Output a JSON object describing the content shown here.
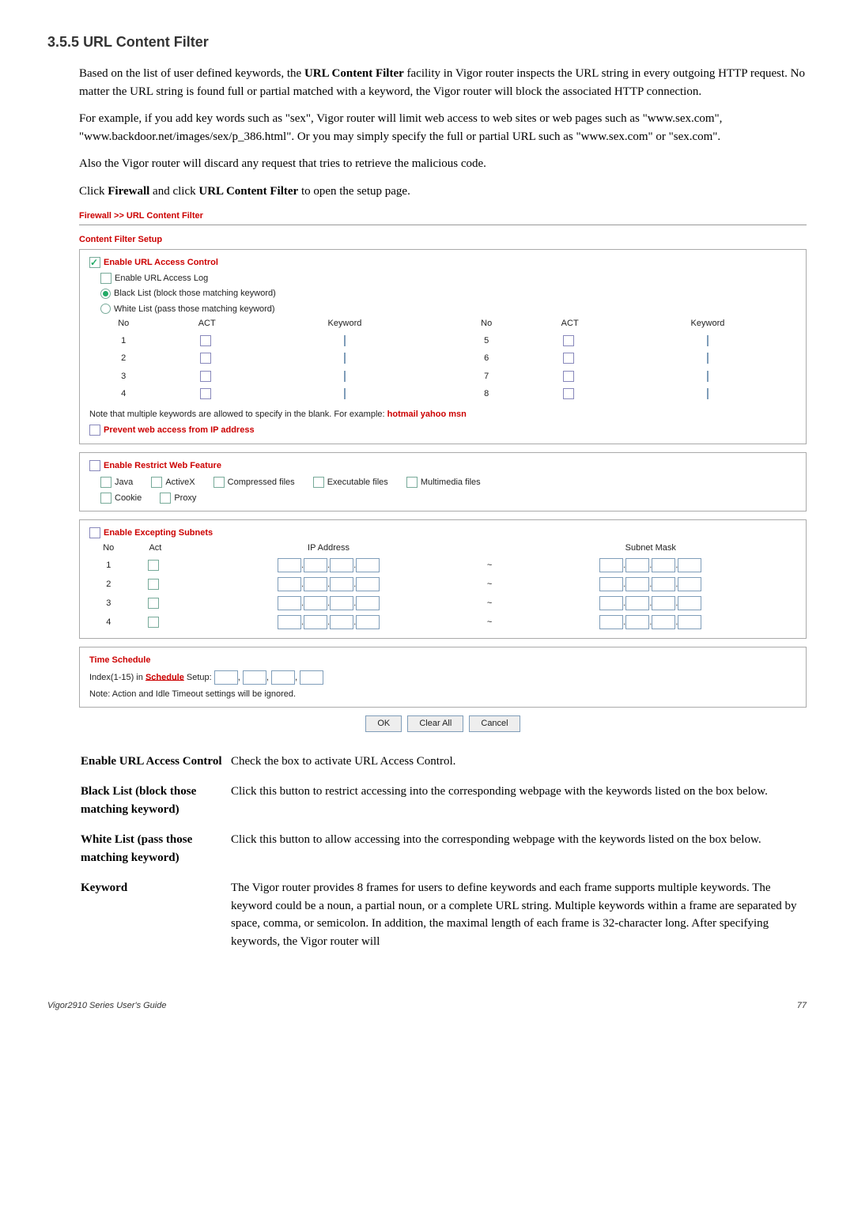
{
  "section": {
    "number": "3.5.5",
    "title": "URL Content Filter"
  },
  "para1_a": "Based on the list of user defined keywords, the ",
  "para1_b": "URL Content Filter",
  "para1_c": " facility in Vigor router inspects the URL string in every outgoing HTTP request. No matter the URL string is found full or partial matched with a keyword, the Vigor router will block the associated HTTP connection.",
  "para2": "For example, if you add key words such as \"sex\", Vigor router will limit web access to web sites or web pages such as \"www.sex.com\", \"www.backdoor.net/images/sex/p_386.html\". Or you may simply specify the full or partial URL such as \"www.sex.com\" or \"sex.com\".",
  "para3": "Also the Vigor router will discard any request that tries to retrieve the malicious code.",
  "para4_a": "Click ",
  "para4_b": "Firewall",
  "para4_c": " and click ",
  "para4_d": "URL Content Filter",
  "para4_e": " to open the setup page.",
  "shot": {
    "breadcrumb": "Firewall >> URL Content Filter",
    "cfs_title": "Content Filter Setup",
    "enable_uac": "Enable URL Access Control",
    "enable_log": "Enable URL Access Log",
    "black_list": "Black List (block those matching keyword)",
    "white_list": "White List (pass those matching keyword)",
    "hdr_no": "No",
    "hdr_act": "ACT",
    "hdr_kw": "Keyword",
    "rows_left": [
      "1",
      "2",
      "3",
      "4"
    ],
    "rows_right": [
      "5",
      "6",
      "7",
      "8"
    ],
    "note_a": "Note that multiple keywords are allowed to specify in the blank. For example: ",
    "note_b": "hotmail yahoo msn",
    "prevent": "Prevent web access from IP address",
    "erwf": "Enable Restrict Web Feature",
    "opts": {
      "java": "Java",
      "activex": "ActiveX",
      "comp": "Compressed files",
      "exec": "Executable files",
      "multi": "Multimedia files",
      "cookie": "Cookie",
      "proxy": "Proxy"
    },
    "ees": "Enable Excepting Subnets",
    "hdr_act2": "Act",
    "hdr_ip": "IP Address",
    "hdr_mask": "Subnet Mask",
    "sub_rows": [
      "1",
      "2",
      "3",
      "4"
    ],
    "tilde": "~",
    "ts": "Time Schedule",
    "idx_a": "Index(1-15) in ",
    "idx_b": "Schedule",
    "idx_c": " Setup:",
    "note2": "Note: Action and Idle Timeout settings will be ignored.",
    "btn_ok": "OK",
    "btn_clear": "Clear All",
    "btn_cancel": "Cancel"
  },
  "defs": [
    {
      "term": "Enable URL Access Control",
      "desc": "Check the box to activate URL Access Control."
    },
    {
      "term": "Black List (block those matching keyword)",
      "desc": "Click this button to restrict accessing into the corresponding webpage with the keywords listed on the box below."
    },
    {
      "term": "White List (pass those matching keyword)",
      "desc": "Click this button to allow accessing into the corresponding webpage with the keywords listed on the box below."
    },
    {
      "term": "Keyword",
      "desc": "The Vigor router provides 8 frames for users to define keywords and each frame supports multiple keywords. The keyword could be a noun, a partial noun, or a complete URL string. Multiple keywords within a frame are separated by space, comma, or semicolon. In addition, the maximal length of each frame is 32-character long. After specifying keywords, the Vigor router will"
    }
  ],
  "footer": {
    "left": "Vigor2910 Series User's Guide",
    "right": "77"
  }
}
